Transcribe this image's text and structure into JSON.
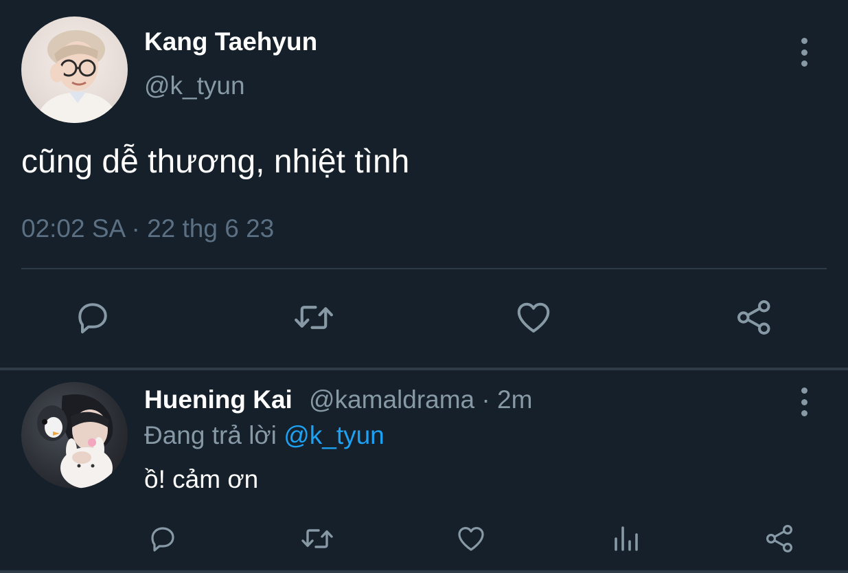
{
  "main_tweet": {
    "author_name": "Kang Taehyun",
    "author_handle": "@k_tyun",
    "text": "cũng dễ thương, nhiệt tình",
    "timestamp": "02:02 SA · 22 thg 6 23"
  },
  "reply": {
    "author_name": "Huening Kai",
    "author_handle": "@kamaldrama",
    "separator": " · ",
    "time": "2m",
    "replying_to_prefix": "Đang trả lời ",
    "replying_to_handle": "@k_tyun",
    "text": "ồ! cảm ơn"
  },
  "icons": {
    "more": "more-vertical-icon",
    "reply": "reply-icon",
    "retweet": "retweet-icon",
    "like": "heart-icon",
    "share": "share-icon",
    "analytics": "analytics-icon"
  },
  "colors": {
    "background": "#15202b",
    "secondary_text": "#8899a6",
    "muted_text": "#5b7083",
    "link": "#1da1f2",
    "divider": "#2f3b47"
  }
}
